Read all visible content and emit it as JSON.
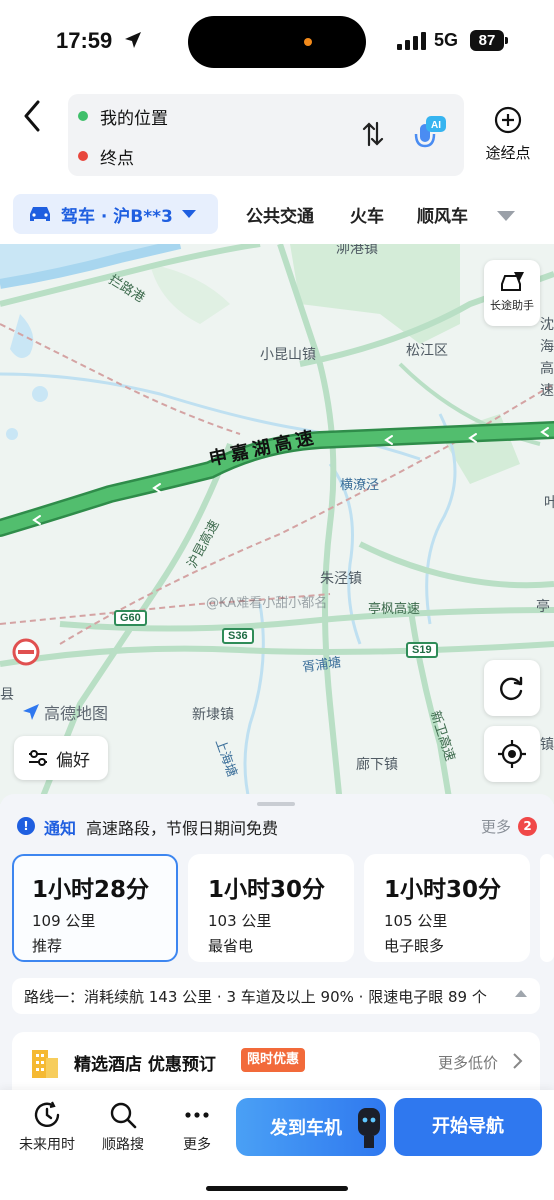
{
  "status": {
    "time": "17:59",
    "network": "5G",
    "battery": "87"
  },
  "header": {
    "origin": "我的位置",
    "destination": "终点",
    "ai_badge": "AI",
    "waypoint_label": "途经点"
  },
  "modes": {
    "active": "驾车 · 沪B**3",
    "tabs": [
      "公共交通",
      "火车",
      "顺风车"
    ]
  },
  "map": {
    "labels": {
      "lanlugang": "拦路港",
      "xiaokunshan": "小昆山镇",
      "songjiang": "松江区",
      "hengliaojing": "横潦泾",
      "hukun": "沪昆高速",
      "zhujing": "朱泾镇",
      "tingfeng": "亭枫高速",
      "xupu": "胥浦塘",
      "xindai": "新埭镇",
      "shanghaitang": "上海塘",
      "liaoxia": "廊下镇",
      "xinwei": "新卫高速",
      "xian": "县",
      "ting": "亭",
      "shen": "沈",
      "hai": "海",
      "gao": "高",
      "su": "速",
      "ye": "叶",
      "zhen": "镇",
      "top_town": "泖港镇"
    },
    "highway_name": "申嘉湖高速",
    "shields": {
      "g60": "G60",
      "s36": "S36",
      "s19": "S19"
    },
    "watermark": "@KA难看小甜小都名",
    "logo": "高德地图",
    "longtrip_label": "长途助手",
    "preference_label": "偏好"
  },
  "notice": {
    "tag": "通知",
    "text": "高速路段，节假日期间免费",
    "more": "更多",
    "badge": "2"
  },
  "routes": [
    {
      "time": "1小时28分",
      "distance": "109 公里",
      "tag": "推荐"
    },
    {
      "time": "1小时30分",
      "distance": "103 公里",
      "tag": "最省电"
    },
    {
      "time": "1小时30分",
      "distance": "105 公里",
      "tag": "电子眼多"
    }
  ],
  "route_info": "路线一：消耗续航 143 公里 · 3 车道及以上 90% · 限速电子眼 89 个",
  "hotel": {
    "title": "精选酒店 优惠预订",
    "tag": "限时优惠",
    "more": "更多低价"
  },
  "bottom": {
    "future_time": "未来用时",
    "search_along": "顺路搜",
    "more": "更多",
    "send_to_car": "发到车机",
    "start_nav": "开始导航"
  },
  "colors": {
    "accent": "#2f78ef",
    "highway": "#4cb86a",
    "map_background": "#eef4f1",
    "badge_red": "#f04848",
    "promo_orange": "#f26a3a"
  }
}
